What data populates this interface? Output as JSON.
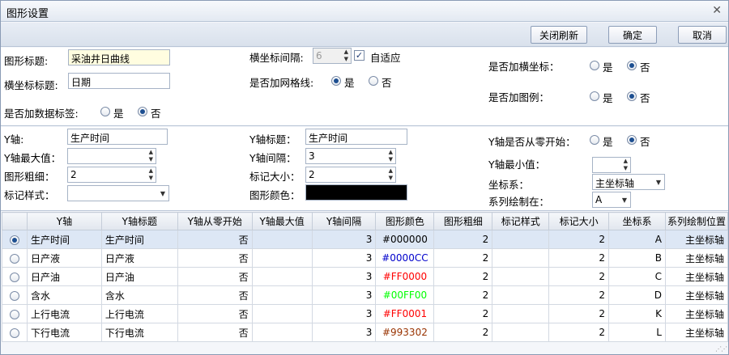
{
  "window": {
    "title": "图形设置",
    "close_glyph": "✕"
  },
  "toolbar": {
    "refresh_label": "关闭刷新",
    "ok_label": "确定",
    "cancel_label": "取消"
  },
  "general": {
    "chart_title_label": "图形标题:",
    "chart_title_value": "采油井日曲线",
    "xaxis_title_label": "横坐标标题:",
    "xaxis_title_value": "日期",
    "data_labels_label": "是否加数据标签:",
    "xaxis_interval_label": "横坐标间隔:",
    "xaxis_interval_value": "6",
    "auto_fit_label": "自适应",
    "gridlines_label": "是否加网格线:",
    "add_xaxis_label": "是否加横坐标：",
    "add_legend_label": "是否加图例：",
    "yes": "是",
    "no": "否"
  },
  "yaxis": {
    "yaxis_label": "Y轴:",
    "yaxis_value": "生产时间",
    "ymax_label": "Y轴最大值：",
    "ymax_value": "",
    "thickness_label": "图形粗细：",
    "thickness_value": "2",
    "marker_style_label": "标记样式：",
    "marker_style_value": "",
    "ytitle_label": "Y轴标题：",
    "ytitle_value": "生产时间",
    "yinterval_label": "Y轴间隔：",
    "yinterval_value": "3",
    "marker_size_label": "标记大小：",
    "marker_size_value": "2",
    "color_label": "图形颜色：",
    "color_value": "#000000",
    "from_zero_label": "Y轴是否从零开始：",
    "ymin_label": "Y轴最小值：",
    "ymin_value": "",
    "coord_label": "坐标系：",
    "coord_value": "主坐标轴",
    "series_pos_label": "系列绘制在：",
    "series_pos_value": "A"
  },
  "grid": {
    "headers": [
      "",
      "Y轴",
      "Y轴标题",
      "Y轴从零开始",
      "Y轴最大值",
      "Y轴间隔",
      "图形颜色",
      "图形粗细",
      "标记样式",
      "标记大小",
      "坐标系",
      "系列绘制位置"
    ],
    "rows": [
      {
        "yaxis": "生产时间",
        "title": "生产时间",
        "zero": "否",
        "max": "",
        "interval": "3",
        "color": "#000000",
        "thick": "2",
        "marker": "",
        "msize": "2",
        "coord": "A",
        "pos": "主坐标轴"
      },
      {
        "yaxis": "日产液",
        "title": "日产液",
        "zero": "否",
        "max": "",
        "interval": "3",
        "color": "#0000CC",
        "thick": "2",
        "marker": "",
        "msize": "2",
        "coord": "B",
        "pos": "主坐标轴"
      },
      {
        "yaxis": "日产油",
        "title": "日产油",
        "zero": "否",
        "max": "",
        "interval": "3",
        "color": "#FF0000",
        "thick": "2",
        "marker": "",
        "msize": "2",
        "coord": "C",
        "pos": "主坐标轴"
      },
      {
        "yaxis": "含水",
        "title": "含水",
        "zero": "否",
        "max": "",
        "interval": "3",
        "color": "#00FF00",
        "thick": "2",
        "marker": "",
        "msize": "2",
        "coord": "D",
        "pos": "主坐标轴"
      },
      {
        "yaxis": "上行电流",
        "title": "上行电流",
        "zero": "否",
        "max": "",
        "interval": "3",
        "color": "#FF0001",
        "thick": "2",
        "marker": "",
        "msize": "2",
        "coord": "K",
        "pos": "主坐标轴"
      },
      {
        "yaxis": "下行电流",
        "title": "下行电流",
        "zero": "否",
        "max": "",
        "interval": "3",
        "color": "#993302",
        "thick": "2",
        "marker": "",
        "msize": "2",
        "coord": "L",
        "pos": "主坐标轴"
      }
    ]
  }
}
